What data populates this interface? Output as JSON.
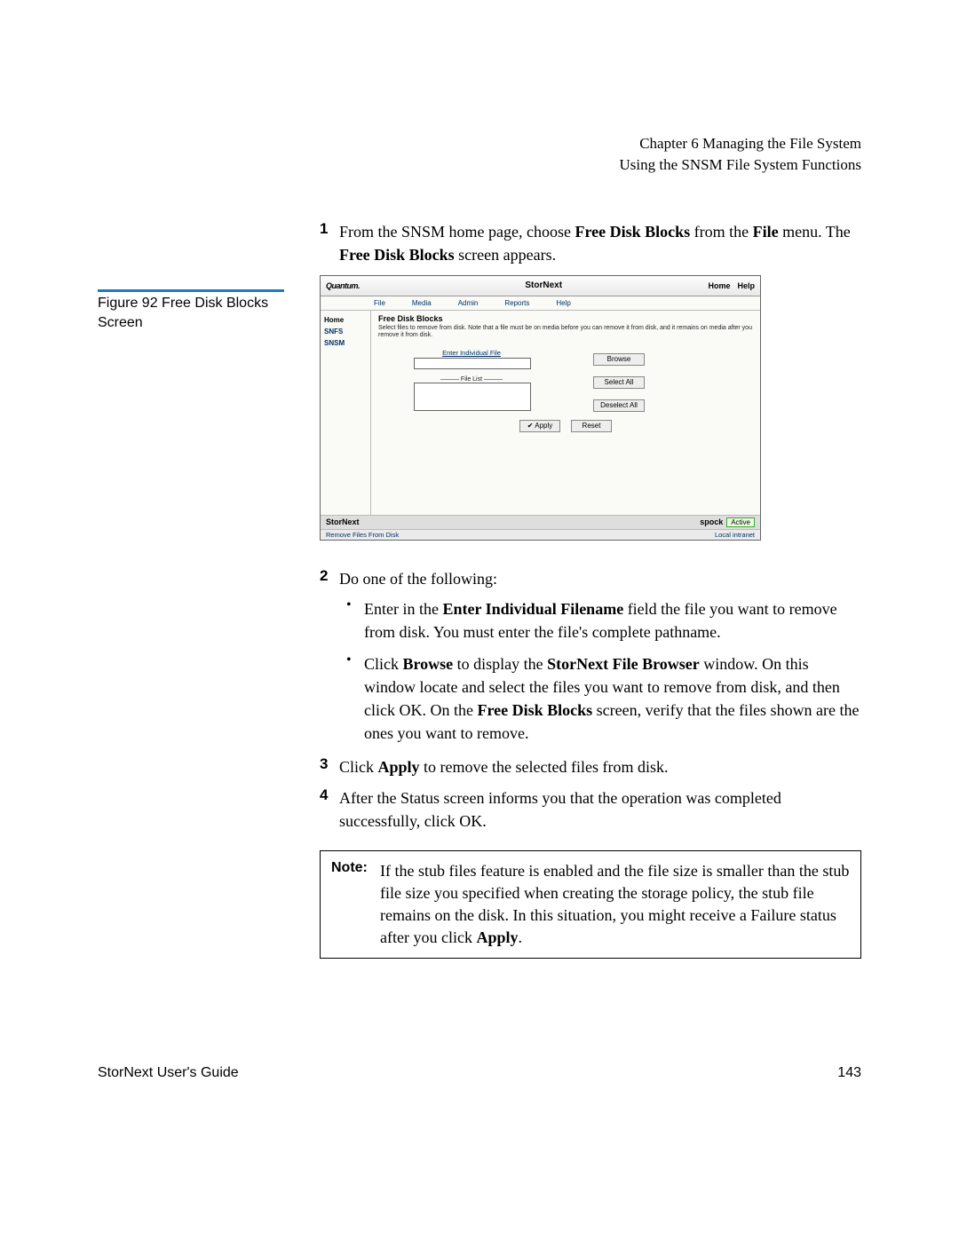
{
  "header": {
    "chapter": "Chapter 6  Managing the File System",
    "section": "Using the SNSM File System Functions"
  },
  "step1": {
    "num": "1",
    "text_a": "From the SNSM home page, choose ",
    "bold_a": "Free Disk Blocks",
    "text_b": " from the ",
    "bold_b": "File",
    "text_c": " menu. The ",
    "bold_c": "Free Disk Blocks",
    "text_d": " screen appears."
  },
  "figure": {
    "caption": "Figure 92  Free Disk Blocks Screen"
  },
  "screenshot": {
    "brand": "Quantum.",
    "title": "StorNext",
    "top_links": [
      "Home",
      "Help"
    ],
    "menu": [
      "File",
      "Media",
      "Admin",
      "Reports",
      "Help"
    ],
    "side_nav": [
      "Home",
      "SNFS",
      "SNSM"
    ],
    "panel_title": "Free Disk Blocks",
    "panel_desc": "Select files to remove from disk. Note that a file must be on media before you can remove it from disk, and it remains on media after you remove it from disk.",
    "field_label": "Enter Individual File",
    "file_list_label": "——— File List ———",
    "browse_btn": "Browse",
    "select_all_btn": "Select All",
    "deselect_all_btn": "Deselect All",
    "apply_btn": "✔ Apply",
    "reset_btn": "Reset",
    "stornext_label": "StorNext",
    "host": "spock",
    "active": "Active",
    "statusbar_left": "Remove Files From Disk",
    "statusbar_right": "Local intranet"
  },
  "step2": {
    "num": "2",
    "text": "Do one of the following:"
  },
  "bullet1": {
    "text_a": "Enter in the ",
    "bold_a": "Enter Individual Filename",
    "text_b": " field the file you want to remove from disk. You must enter the file's complete pathname."
  },
  "bullet2": {
    "text_a": "Click ",
    "bold_a": "Browse",
    "text_b": " to display the ",
    "bold_b": "StorNext File Browser",
    "text_c": " window. On this window locate and select the files you want to remove from disk, and then click OK. On the ",
    "bold_c": "Free Disk Blocks",
    "text_d": " screen, verify that the files shown are the ones you want to remove."
  },
  "step3": {
    "num": "3",
    "text_a": "Click ",
    "bold_a": "Apply",
    "text_b": " to remove the selected files from disk."
  },
  "step4": {
    "num": "4",
    "text": "After the Status screen informs you that the operation was completed successfully, click OK."
  },
  "note": {
    "label": "Note:",
    "text_a": "If the stub files feature is enabled and the file size is smaller than the stub file size you specified when creating the storage policy, the stub file remains on the disk. In this situation, you might receive a Failure status after you click ",
    "bold_a": "Apply",
    "text_b": "."
  },
  "footer": {
    "left": "StorNext User's Guide",
    "right": "143"
  }
}
